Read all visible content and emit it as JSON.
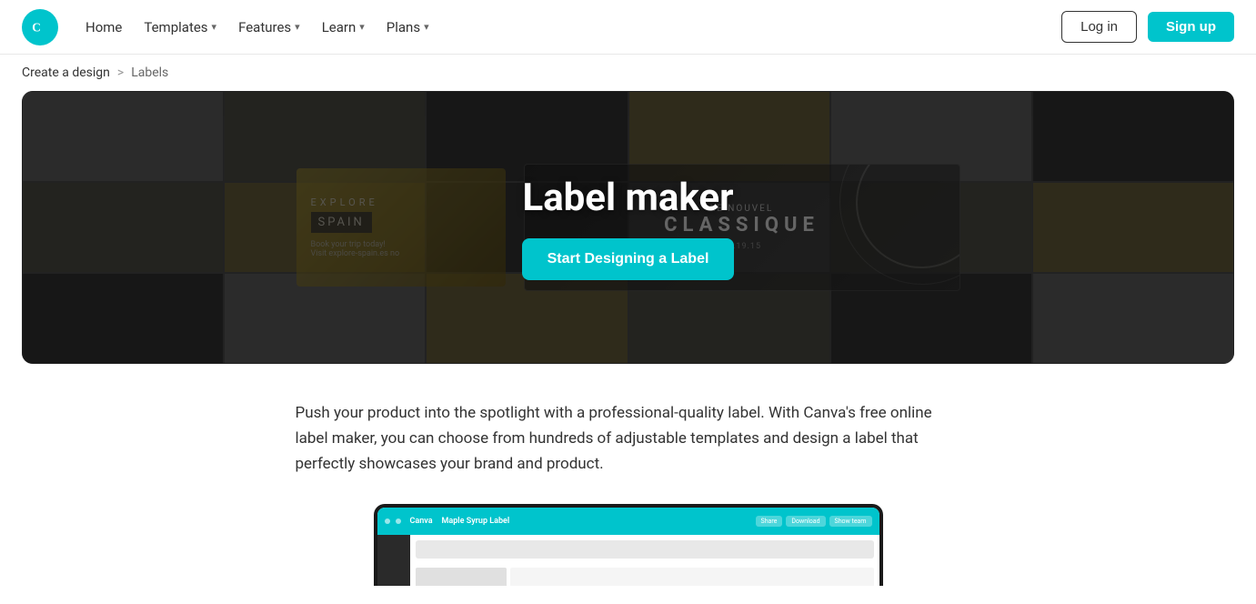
{
  "brand": {
    "name": "Canva",
    "color": "#00c4cc"
  },
  "navbar": {
    "home_label": "Home",
    "templates_label": "Templates",
    "features_label": "Features",
    "learn_label": "Learn",
    "plans_label": "Plans",
    "login_label": "Log in",
    "signup_label": "Sign up"
  },
  "breadcrumb": {
    "parent_label": "Create a design",
    "separator": ">",
    "current_label": "Labels"
  },
  "hero": {
    "title": "Label maker",
    "cta_label": "Start Designing a Label"
  },
  "description": {
    "text": "Push your product into the spotlight with a professional-quality label. With Canva's free online label maker, you can choose from hundreds of adjustable templates and design a label that perfectly showcases your brand and product."
  },
  "device_preview": {
    "top_bar_title": "Maple Syrup Label",
    "share_label": "Share",
    "download_label": "Download",
    "show_team_label": "Show team",
    "canva_label": "Canva"
  },
  "template_cards": {
    "card1": {
      "line1": "EXPLORE",
      "line2": "SPAIN",
      "line3": "Book your trip today!",
      "line4": "Visit explore-spain.es no"
    },
    "card2": {
      "line1": "LE NOUVEL",
      "line2": "CLASSIQUE",
      "line3": "05.19.15"
    }
  }
}
